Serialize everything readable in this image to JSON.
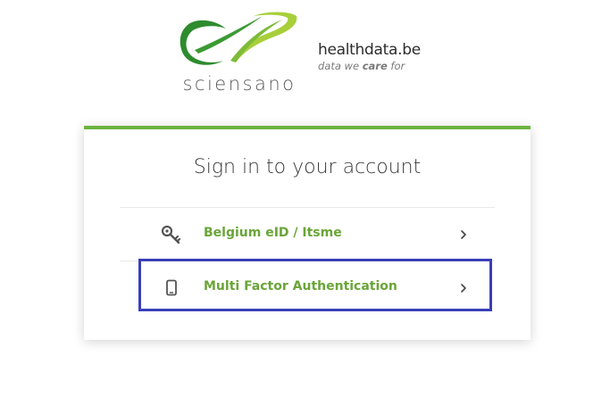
{
  "branding": {
    "logo_word": "sciensano",
    "partner_name": "healthdata.be",
    "tagline_prefix": "data we ",
    "tagline_emphasis": "care",
    "tagline_suffix": " for"
  },
  "login": {
    "title": "Sign in to your account",
    "options": [
      {
        "label": "Belgium eID / Itsme",
        "icon": "key-icon"
      },
      {
        "label": "Multi Factor Authentication",
        "icon": "mobile-phone-icon"
      }
    ]
  },
  "colors": {
    "accent_green": "#6cb33f",
    "option_text_green": "#6aa539",
    "highlight_blue": "#3a3fb8"
  }
}
